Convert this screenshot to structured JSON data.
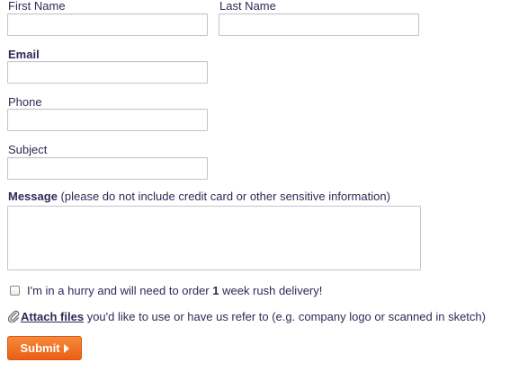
{
  "form": {
    "first_name": {
      "label": "First Name",
      "value": ""
    },
    "last_name": {
      "label": "Last Name",
      "value": ""
    },
    "email": {
      "label": "Email",
      "value": ""
    },
    "phone": {
      "label": "Phone",
      "value": ""
    },
    "subject": {
      "label": "Subject",
      "value": ""
    },
    "message": {
      "label": "Message",
      "note": "(please do not include credit card or other sensitive information)",
      "value": ""
    },
    "rush": {
      "checked": false,
      "text_before": "I'm in a hurry and will need to order ",
      "text_bold": "1",
      "text_after": " week rush delivery!"
    },
    "attach": {
      "icon": "paperclip-icon",
      "link_label": "Attach files",
      "text_after": " you'd like to use or have us refer to (e.g. company logo or scanned in sketch)"
    },
    "submit_label": "Submit"
  },
  "colors": {
    "text": "#2e2a57",
    "input_border": "#c4c4cc",
    "submit_bg": "#f07a2a"
  }
}
